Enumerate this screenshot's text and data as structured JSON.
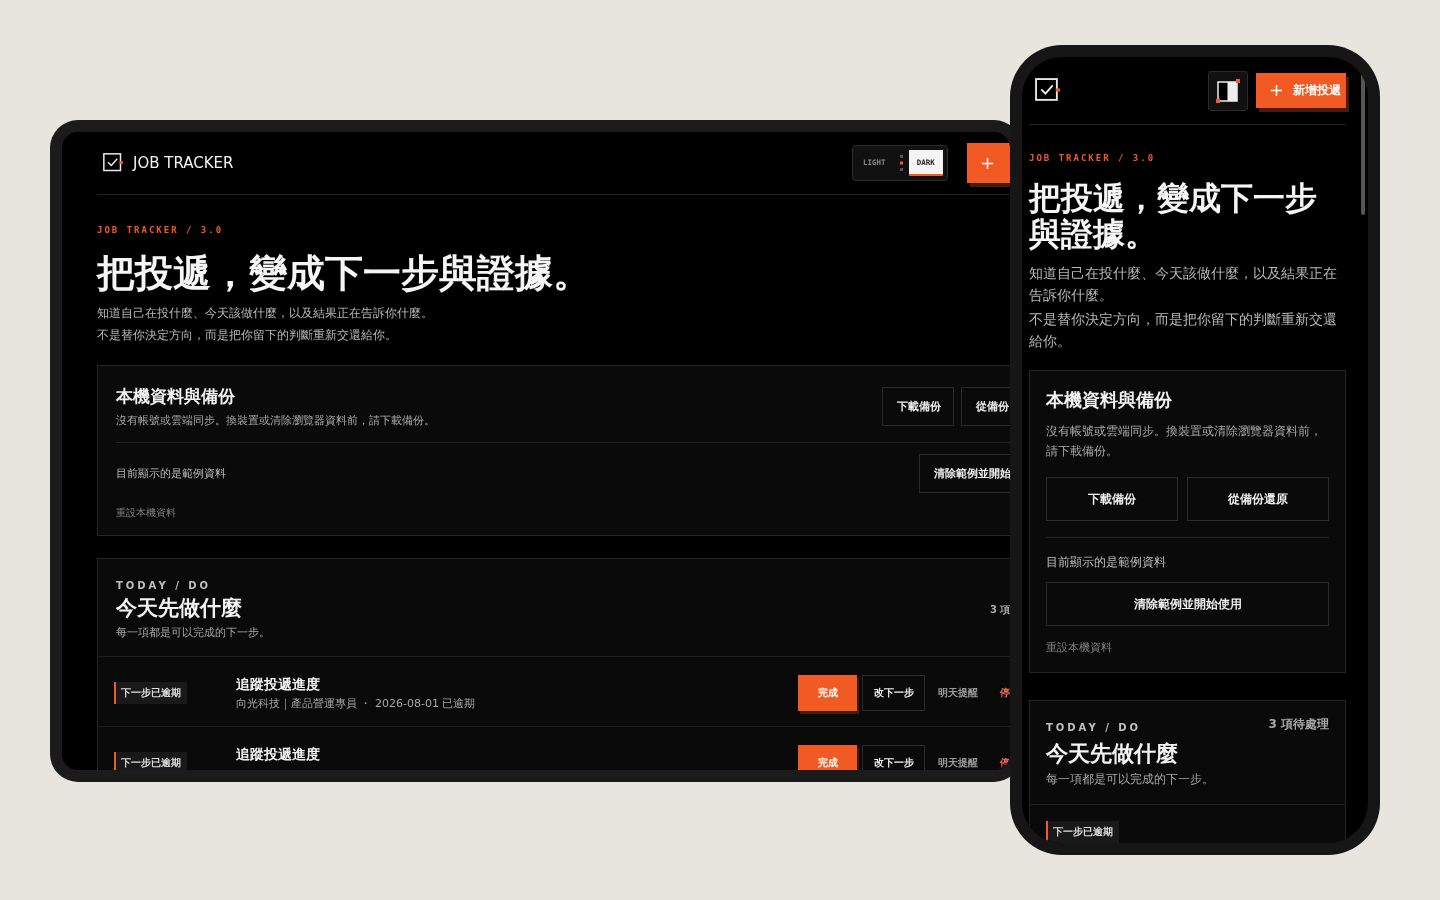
{
  "tablet": {
    "header": {
      "brand": "JOB TRACKER",
      "theme_options": [
        {
          "label": "LIGHT",
          "selected": false
        },
        {
          "label": "DARK",
          "selected": true
        }
      ]
    },
    "hero": {
      "eyebrow": "JOB TRACKER / 3.0",
      "title": "把投遞，變成下一步與證據。",
      "lines": [
        "知道自己在投什麼、今天該做什麼，以及結果正在告訴你什麼。",
        "不是替你決定方向，而是把你留下的判斷重新交還給你。"
      ]
    },
    "backup": {
      "title": "本機資料與備份",
      "note": "沒有帳號或雲端同步。換裝置或清除瀏覽器資料前，請下載備份。",
      "buttons": [
        "下載備份",
        "從備份"
      ],
      "sample_label": "目前顯示的是範例資料",
      "clear_button": "清除範例並開始",
      "reset_link": "重設本機資料"
    },
    "today": {
      "eyebrow": "TODAY / DO",
      "title": "今天先做什麼",
      "subtitle": "每一項都是可以完成的下一步。",
      "count": "3 項",
      "tasks": [
        {
          "tag": "下一步已逾期",
          "title": "追蹤投遞進度",
          "meta": "向光科技｜產品營運專員 ・ 2026-08-01 已逾期",
          "actions": [
            {
              "label": "完成",
              "kind": "primary"
            },
            {
              "label": "改下一步",
              "kind": "outline"
            },
            {
              "label": "明天提醒",
              "kind": "text"
            },
            {
              "label": "停",
              "kind": "danger"
            }
          ]
        },
        {
          "tag": "下一步已逾期",
          "title": "追蹤投遞進度",
          "actions": [
            {
              "label": "完成",
              "kind": "primary"
            },
            {
              "label": "改下一步",
              "kind": "outline"
            },
            {
              "label": "明天提醒",
              "kind": "text"
            },
            {
              "label": "停",
              "kind": "danger"
            }
          ]
        }
      ]
    }
  },
  "phone": {
    "header": {
      "add_button": "新增投遞"
    },
    "hero": {
      "eyebrow": "JOB TRACKER / 3.0",
      "title": "把投遞，變成下一步與證據。",
      "lines": [
        "知道自己在投什麼、今天該做什麼，以及結果正在告訴你什麼。",
        "不是替你決定方向，而是把你留下的判斷重新交還給你。"
      ]
    },
    "backup": {
      "title": "本機資料與備份",
      "note": "沒有帳號或雲端同步。換裝置或清除瀏覽器資料前，請下載備份。",
      "buttons": [
        "下載備份",
        "從備份還原"
      ],
      "sample_label": "目前顯示的是範例資料",
      "clear_button": "清除範例並開始使用",
      "reset_link": "重設本機資料"
    },
    "today": {
      "eyebrow": "TODAY / DO",
      "title": "今天先做什麼",
      "subtitle": "每一項都是可以完成的下一步。",
      "count": "3 項待處理",
      "tasks": [
        {
          "tag": "下一步已逾期"
        }
      ]
    }
  }
}
